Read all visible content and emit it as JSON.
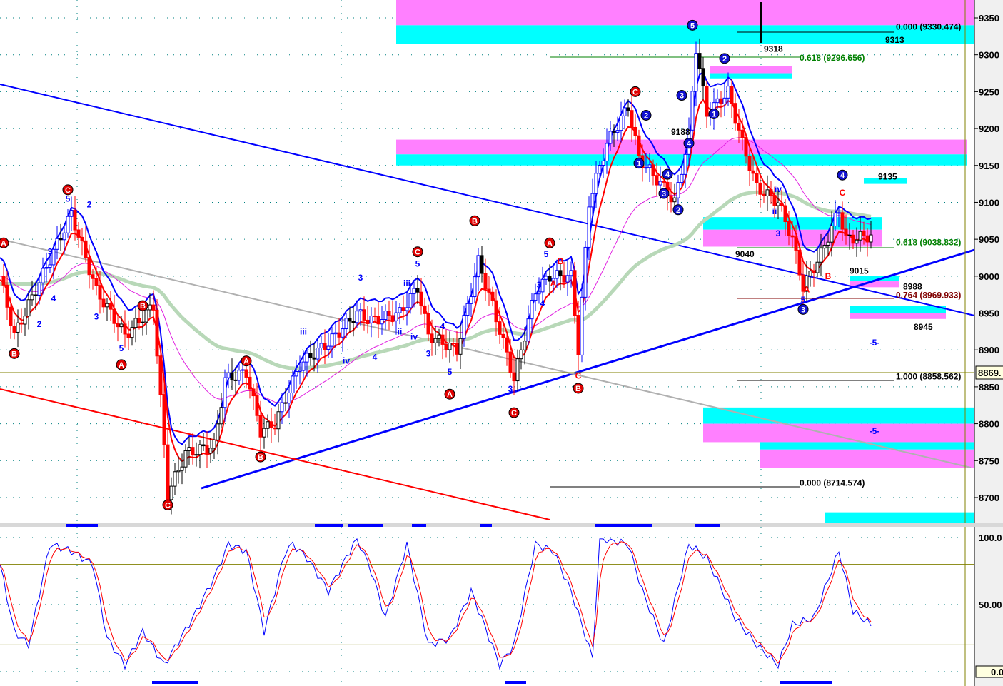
{
  "chart_data": {
    "type": "candlestick",
    "title": "",
    "price_axis": {
      "ticks": [
        9350,
        9300,
        9250,
        9200,
        9150,
        9100,
        9050,
        9000,
        8950,
        8900,
        8850,
        8800,
        8750,
        8700
      ],
      "ylim": [
        8675,
        9375
      ]
    },
    "current_price_label": "8869.",
    "current_price": 8869,
    "close_keypoints": [
      [
        0,
        9000
      ],
      [
        4,
        8920
      ],
      [
        20,
        9085
      ],
      [
        27,
        8980
      ],
      [
        35,
        8920
      ],
      [
        43,
        8960
      ],
      [
        47,
        8705
      ],
      [
        52,
        8760
      ],
      [
        60,
        8770
      ],
      [
        63,
        8860
      ],
      [
        69,
        8870
      ],
      [
        73,
        8790
      ],
      [
        77,
        8800
      ],
      [
        84,
        8880
      ],
      [
        92,
        8910
      ],
      [
        100,
        8950
      ],
      [
        104,
        8940
      ],
      [
        112,
        8950
      ],
      [
        117,
        8985
      ],
      [
        120,
        8920
      ],
      [
        128,
        8900
      ],
      [
        134,
        9020
      ],
      [
        138,
        8960
      ],
      [
        144,
        8860
      ],
      [
        150,
        8980
      ],
      [
        154,
        9000
      ],
      [
        160,
        9000
      ],
      [
        162,
        8900
      ],
      [
        165,
        9100
      ],
      [
        170,
        9180
      ],
      [
        176,
        9230
      ],
      [
        179,
        9160
      ],
      [
        186,
        9120
      ],
      [
        189,
        9100
      ],
      [
        193,
        9190
      ],
      [
        195,
        9310
      ],
      [
        198,
        9220
      ],
      [
        204,
        9250
      ],
      [
        208,
        9180
      ],
      [
        212,
        9120
      ],
      [
        218,
        9100
      ],
      [
        222,
        9050
      ],
      [
        225,
        8985
      ],
      [
        230,
        9030
      ],
      [
        235,
        9090
      ],
      [
        237,
        9050
      ],
      [
        244,
        9055
      ]
    ],
    "zones": [
      {
        "from_bar": 111,
        "to_bar": 273,
        "low": 9340,
        "high": 9375,
        "color": "#ff80ff"
      },
      {
        "from_bar": 111,
        "to_bar": 273,
        "low": 9315,
        "high": 9340,
        "color": "#00ffff"
      },
      {
        "from_bar": 111,
        "to_bar": 271,
        "low": 9165,
        "high": 9185,
        "color": "#ff80ff"
      },
      {
        "from_bar": 111,
        "to_bar": 271,
        "low": 9150,
        "high": 9165,
        "color": "#00ffff"
      },
      {
        "from_bar": 199,
        "to_bar": 222,
        "low": 9275,
        "high": 9285,
        "color": "#ff80ff"
      },
      {
        "from_bar": 199,
        "to_bar": 222,
        "low": 9268,
        "high": 9275,
        "color": "#00ffff"
      },
      {
        "from_bar": 197,
        "to_bar": 247,
        "low": 9063,
        "high": 9080,
        "color": "#00ffff"
      },
      {
        "from_bar": 197,
        "to_bar": 247,
        "low": 9040,
        "high": 9063,
        "color": "#ff80ff"
      },
      {
        "from_bar": 242,
        "to_bar": 254,
        "low": 9125,
        "high": 9133,
        "color": "#00ffff"
      },
      {
        "from_bar": 238,
        "to_bar": 252,
        "low": 8993,
        "high": 9000,
        "color": "#00ffff"
      },
      {
        "from_bar": 238,
        "to_bar": 252,
        "low": 8985,
        "high": 8993,
        "color": "#ff80ff"
      },
      {
        "from_bar": 238,
        "to_bar": 265,
        "low": 8950,
        "high": 8960,
        "color": "#00ffff"
      },
      {
        "from_bar": 238,
        "to_bar": 265,
        "low": 8942,
        "high": 8950,
        "color": "#ff80ff"
      },
      {
        "from_bar": 197,
        "to_bar": 273,
        "low": 8800,
        "high": 8822,
        "color": "#00ffff"
      },
      {
        "from_bar": 197,
        "to_bar": 273,
        "low": 8775,
        "high": 8800,
        "color": "#ff80ff"
      },
      {
        "from_bar": 213,
        "to_bar": 273,
        "low": 8765,
        "high": 8775,
        "color": "#00ffff"
      },
      {
        "from_bar": 213,
        "to_bar": 273,
        "low": 8740,
        "high": 8765,
        "color": "#ff80ff"
      },
      {
        "from_bar": 231,
        "to_bar": 273,
        "low": 8665,
        "high": 8680,
        "color": "#00ffff"
      }
    ],
    "fib_labels": [
      {
        "text": "0.000 (9330.474)",
        "bar": 251,
        "price": 9338,
        "color": "#000000"
      },
      {
        "text": "0.618 (9296.656)",
        "bar": 224,
        "price": 9296,
        "color": "#008000"
      },
      {
        "text": "0.618 (9038.832)",
        "bar": 251,
        "price": 9046,
        "color": "#008000"
      },
      {
        "text": "0.764 (8969.933)",
        "bar": 251,
        "price": 8974,
        "color": "#800000"
      },
      {
        "text": "1.000 (8858.562)",
        "bar": 251,
        "price": 8864,
        "color": "#000000"
      },
      {
        "text": "0.000 (8714.574)",
        "bar": 224,
        "price": 8720,
        "color": "#000000"
      }
    ],
    "price_labels": [
      {
        "text": "9318",
        "bar": 214,
        "price": 9308
      },
      {
        "text": "9313",
        "bar": 248,
        "price": 9320
      },
      {
        "text": "9135",
        "bar": 246,
        "price": 9135
      },
      {
        "text": "9040",
        "bar": 206,
        "price": 9030
      },
      {
        "text": "9015",
        "bar": 238,
        "price": 9007
      },
      {
        "text": "8988",
        "bar": 253,
        "price": 8986
      },
      {
        "text": "8945",
        "bar": 256,
        "price": 8931
      },
      {
        "text": "9188",
        "bar": 188,
        "price": 9195
      }
    ],
    "wave_labels": [
      {
        "text": "C",
        "bar": 19,
        "price": 9117,
        "style": "red-circle"
      },
      {
        "text": "A",
        "bar": 1,
        "price": 9045,
        "style": "red-circle"
      },
      {
        "text": "B",
        "bar": 4,
        "price": 8895,
        "style": "red-circle"
      },
      {
        "text": "B",
        "bar": 40,
        "price": 8960,
        "style": "red-circle"
      },
      {
        "text": "A",
        "bar": 34,
        "price": 8880,
        "style": "red-circle"
      },
      {
        "text": "C",
        "bar": 47,
        "price": 8690,
        "style": "red-circle"
      },
      {
        "text": "A",
        "bar": 69,
        "price": 8885,
        "style": "red-circle"
      },
      {
        "text": "B",
        "bar": 73,
        "price": 8755,
        "style": "red-circle"
      },
      {
        "text": "C",
        "bar": 117,
        "price": 9033,
        "style": "red-circle"
      },
      {
        "text": "B",
        "bar": 133,
        "price": 9075,
        "style": "red-circle"
      },
      {
        "text": "A",
        "bar": 126,
        "price": 8840,
        "style": "red-circle"
      },
      {
        "text": "C",
        "bar": 144,
        "price": 8815,
        "style": "red-circle"
      },
      {
        "text": "A",
        "bar": 154,
        "price": 9045,
        "style": "red-circle"
      },
      {
        "text": "B",
        "bar": 162,
        "price": 8848,
        "style": "red-circle"
      },
      {
        "text": "C",
        "bar": 178,
        "price": 9250,
        "style": "red-circle"
      },
      {
        "text": "5",
        "bar": 194,
        "price": 9340,
        "style": "blue-circle"
      },
      {
        "text": "2",
        "bar": 203,
        "price": 9295,
        "style": "blue-circle"
      },
      {
        "text": "1",
        "bar": 200,
        "price": 9220,
        "style": "blue-circle"
      },
      {
        "text": "3",
        "bar": 191,
        "price": 9245,
        "style": "blue-circle"
      },
      {
        "text": "4",
        "bar": 193,
        "price": 9180,
        "style": "blue-circle"
      },
      {
        "text": "2",
        "bar": 181,
        "price": 9218,
        "style": "blue-circle"
      },
      {
        "text": "1",
        "bar": 179,
        "price": 9153,
        "style": "blue-circle"
      },
      {
        "text": "4",
        "bar": 187,
        "price": 9138,
        "style": "blue-circle"
      },
      {
        "text": "3",
        "bar": 186,
        "price": 9112,
        "style": "blue-circle"
      },
      {
        "text": "2",
        "bar": 190,
        "price": 9090,
        "style": "blue-circle"
      },
      {
        "text": "4",
        "bar": 236,
        "price": 9137,
        "style": "blue-circle"
      },
      {
        "text": "3",
        "bar": 225,
        "price": 8955,
        "style": "blue-circle"
      },
      {
        "text": "5",
        "bar": 19,
        "price": 9105,
        "style": "blue"
      },
      {
        "text": "2",
        "bar": 25,
        "price": 9097,
        "style": "blue"
      },
      {
        "text": "3",
        "bar": 14,
        "price": 9033,
        "style": "blue"
      },
      {
        "text": "4",
        "bar": 15,
        "price": 8970,
        "style": "blue"
      },
      {
        "text": "2",
        "bar": 11,
        "price": 8935,
        "style": "blue"
      },
      {
        "text": "3",
        "bar": 27,
        "price": 8945,
        "style": "blue"
      },
      {
        "text": "5",
        "bar": 34,
        "price": 8902,
        "style": "blue"
      },
      {
        "text": "iii",
        "bar": 85,
        "price": 8925,
        "style": "blue"
      },
      {
        "text": "iv",
        "bar": 97,
        "price": 8885,
        "style": "blue"
      },
      {
        "text": "4",
        "bar": 105,
        "price": 8890,
        "style": "blue"
      },
      {
        "text": "3",
        "bar": 101,
        "price": 8998,
        "style": "blue"
      },
      {
        "text": "5",
        "bar": 117,
        "price": 9017,
        "style": "blue"
      },
      {
        "text": "iii",
        "bar": 114,
        "price": 8990,
        "style": "blue"
      },
      {
        "text": "iv",
        "bar": 116,
        "price": 8918,
        "style": "blue"
      },
      {
        "text": "ii",
        "bar": 112,
        "price": 8925,
        "style": "blue"
      },
      {
        "text": "3",
        "bar": 120,
        "price": 8895,
        "style": "blue"
      },
      {
        "text": "4",
        "bar": 124,
        "price": 8932,
        "style": "blue"
      },
      {
        "text": "5",
        "bar": 126,
        "price": 8870,
        "style": "blue"
      },
      {
        "text": "3",
        "bar": 143,
        "price": 8847,
        "style": "blue"
      },
      {
        "text": "5",
        "bar": 153,
        "price": 9030,
        "style": "blue"
      },
      {
        "text": "3",
        "bar": 151,
        "price": 8988,
        "style": "blue"
      },
      {
        "text": "4",
        "bar": 152,
        "price": 8963,
        "style": "blue"
      },
      {
        "text": "iv",
        "bar": 218,
        "price": 9118,
        "style": "blue"
      },
      {
        "text": "ii",
        "bar": 217,
        "price": 9088,
        "style": "blue"
      },
      {
        "text": "3",
        "bar": 218,
        "price": 9058,
        "style": "blue"
      },
      {
        "text": "5",
        "bar": 225,
        "price": 8968,
        "style": "blue"
      },
      {
        "text": "-5-",
        "bar": 245,
        "price": 8910,
        "style": "blue"
      },
      {
        "text": "-5-",
        "bar": 245,
        "price": 8790,
        "style": "blue"
      },
      {
        "text": "A",
        "bar": 155,
        "price": 8990,
        "style": "red"
      },
      {
        "text": "B",
        "bar": 157,
        "price": 9020,
        "style": "red"
      },
      {
        "text": "C",
        "bar": 162,
        "price": 8865,
        "style": "red"
      },
      {
        "text": "A",
        "bar": 226,
        "price": 8982,
        "style": "red"
      },
      {
        "text": "B",
        "bar": 232,
        "price": 9000,
        "style": "red"
      },
      {
        "text": "C",
        "bar": 236,
        "price": 9113,
        "style": "red"
      }
    ],
    "oscillator": {
      "ticks": [
        "100.0",
        "50.00",
        "0.0"
      ],
      "levels": [
        80,
        20
      ],
      "keypoints": [
        [
          0,
          80
        ],
        [
          4,
          30
        ],
        [
          8,
          20
        ],
        [
          14,
          95
        ],
        [
          20,
          90
        ],
        [
          26,
          80
        ],
        [
          30,
          25
        ],
        [
          35,
          5
        ],
        [
          40,
          30
        ],
        [
          46,
          5
        ],
        [
          54,
          40
        ],
        [
          60,
          70
        ],
        [
          64,
          95
        ],
        [
          69,
          90
        ],
        [
          74,
          30
        ],
        [
          80,
          90
        ],
        [
          82,
          95
        ],
        [
          86,
          85
        ],
        [
          92,
          60
        ],
        [
          100,
          100
        ],
        [
          104,
          75
        ],
        [
          108,
          40
        ],
        [
          114,
          95
        ],
        [
          120,
          20
        ],
        [
          126,
          25
        ],
        [
          132,
          60
        ],
        [
          140,
          5
        ],
        [
          144,
          20
        ],
        [
          150,
          95
        ],
        [
          155,
          90
        ],
        [
          160,
          60
        ],
        [
          166,
          10
        ],
        [
          168,
          100
        ],
        [
          176,
          95
        ],
        [
          180,
          60
        ],
        [
          186,
          20
        ],
        [
          193,
          95
        ],
        [
          198,
          85
        ],
        [
          206,
          40
        ],
        [
          212,
          20
        ],
        [
          218,
          5
        ],
        [
          222,
          35
        ],
        [
          228,
          40
        ],
        [
          235,
          90
        ],
        [
          239,
          45
        ],
        [
          244,
          35
        ]
      ]
    },
    "colors": {
      "up": "#0000ff",
      "down": "#ff0000",
      "ma_long": "#b8d8b8",
      "ma_mid": "#e020e0"
    }
  }
}
